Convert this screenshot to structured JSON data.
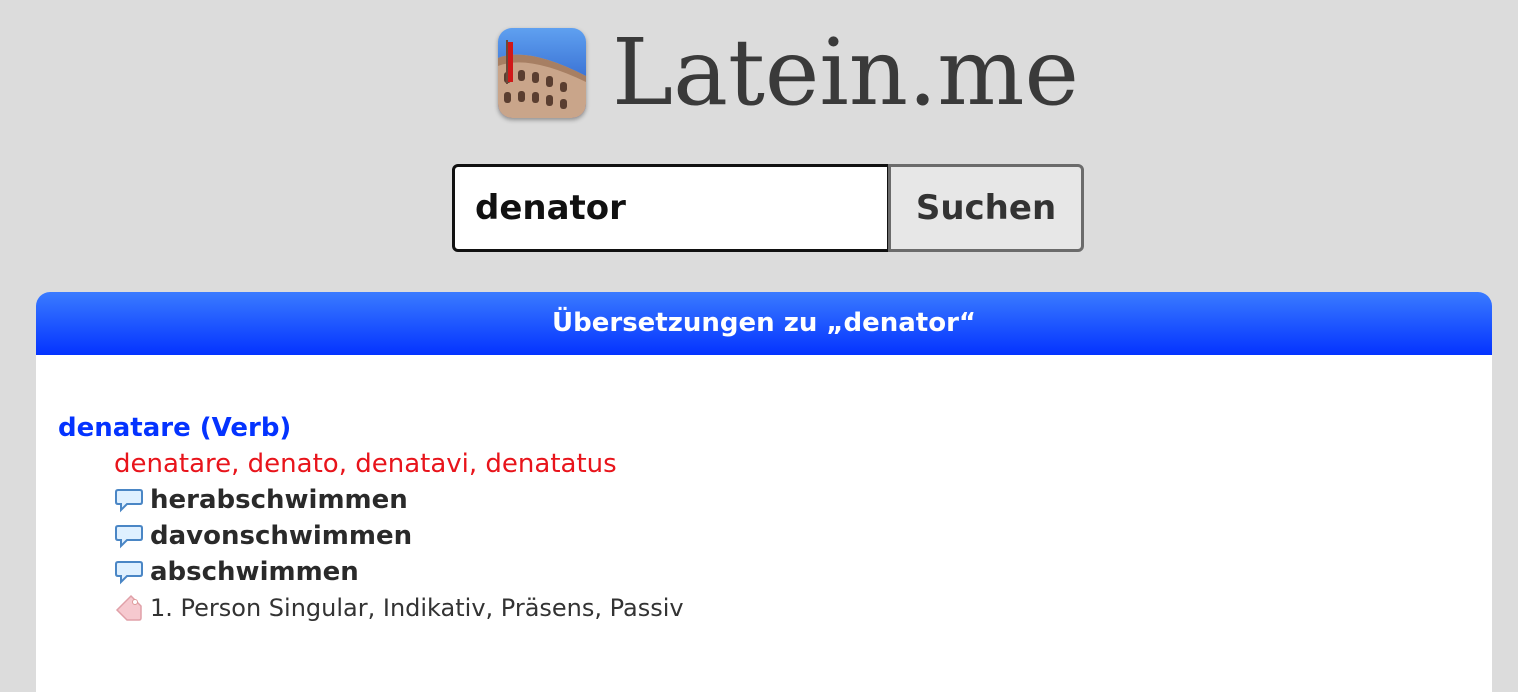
{
  "header": {
    "site_title": "Latein.me",
    "logo_icon": "colosseum-logo-icon"
  },
  "search": {
    "value": "denator",
    "button_label": "Suchen"
  },
  "results": {
    "title": "Übersetzungen zu „denator“",
    "entries": [
      {
        "lemma": "denatare (Verb)",
        "principal_parts": "denatare, denato, denatavi, denatatus",
        "meanings": [
          "herabschwimmen",
          "davonschwimmen",
          "abschwimmen"
        ],
        "grammar": "1. Person Singular, Indikativ, Präsens, Passiv"
      }
    ]
  },
  "colors": {
    "page_background": "#dcdcdc",
    "header_blue": "#0433ff",
    "lemma_blue": "#0433ff",
    "forms_red": "#e8141b"
  }
}
